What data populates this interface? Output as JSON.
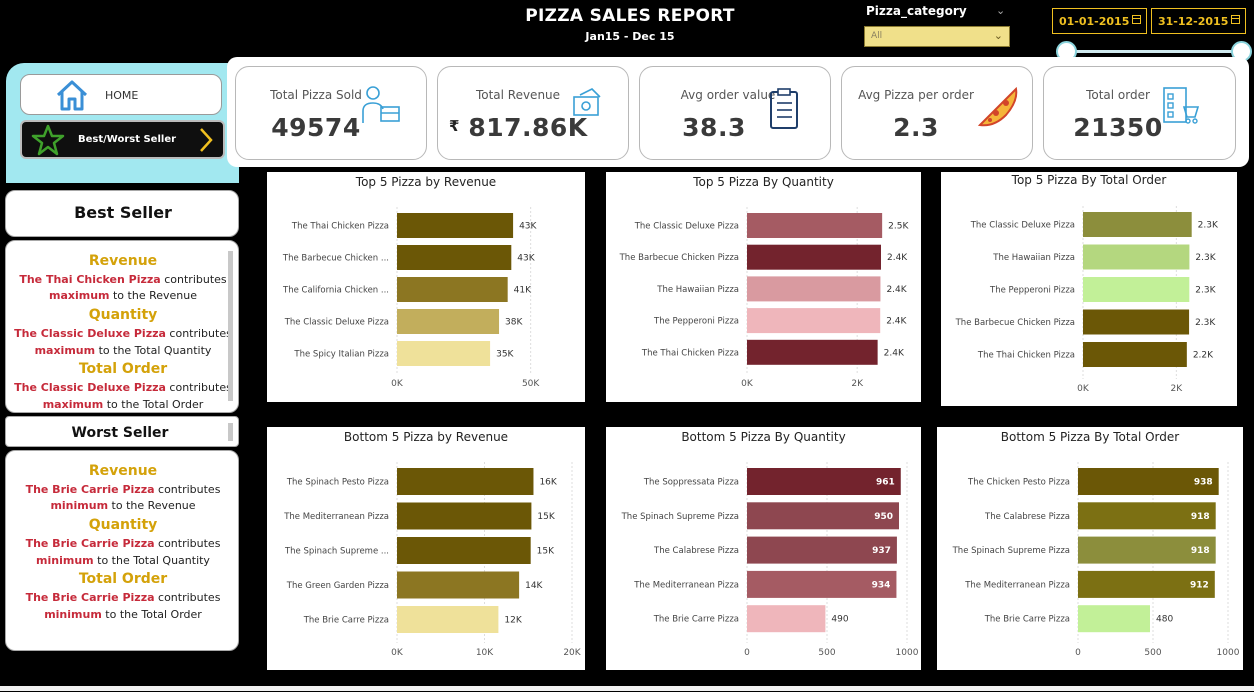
{
  "header": {
    "title": "PIZZA SALES REPORT",
    "subtitle": "Jan15 - Dec 15"
  },
  "filters": {
    "category_label": "Pizza_category",
    "category_value": "All",
    "date_start": "01-01-2015",
    "date_end": "31-12-2015"
  },
  "nav": {
    "home_label": "HOME",
    "bestworst_label": "Best/Worst Seller"
  },
  "kpis": [
    {
      "label": "Total Pizza Sold",
      "value": "49574",
      "icon": "delivery-person-icon"
    },
    {
      "label": "Total Revenue",
      "value": "817.86K",
      "currency": "₹",
      "icon": "money-icon"
    },
    {
      "label": "Avg order value",
      "value": "38.3",
      "icon": "clipboard-icon"
    },
    {
      "label": "Avg Pizza per order",
      "value": "2.3",
      "icon": "pizza-slice-icon"
    },
    {
      "label": "Total order",
      "value": "21350",
      "icon": "order-list-icon"
    }
  ],
  "best_seller": {
    "title": "Best Seller",
    "items": [
      {
        "heading": "Revenue",
        "pizza": "The Thai Chicken Pizza",
        "text1": " contributes",
        "emph": "maximum",
        "text2": " to the Revenue"
      },
      {
        "heading": "Quantity",
        "pizza": "The Classic Deluxe Pizza",
        "text1": " contributes",
        "emph": "maximum",
        "text2": " to the Total Quantity"
      },
      {
        "heading": "Total Order",
        "pizza": "The Classic Deluxe Pizza",
        "text1": " contributes",
        "emph": "maximum",
        "text2": " to the Total Order"
      }
    ]
  },
  "worst_seller": {
    "title": "Worst Seller",
    "items": [
      {
        "heading": "Revenue",
        "pizza": "The Brie Carrie  Pizza",
        "text1": " contributes",
        "emph": "minimum",
        "text2": " to the Revenue"
      },
      {
        "heading": "Quantity",
        "pizza": "The Brie Carrie Pizza",
        "text1": "  contributes",
        "emph": "minimum",
        "text2": " to the Total Quantity"
      },
      {
        "heading": "Total Order",
        "pizza": "The Brie Carrie Pizza",
        "text1": " contributes",
        "emph": "minimum",
        "text2": " to the Total Order"
      }
    ]
  },
  "chart_data": [
    {
      "type": "bar",
      "orientation": "horizontal",
      "title": "Top 5 Pizza by Revenue",
      "categories": [
        "The Thai Chicken Pizza",
        "The Barbecue Chicken ...",
        "The California Chicken ...",
        "The Classic Deluxe Pizza",
        "The Spicy Italian Pizza"
      ],
      "values": [
        43434,
        42768,
        41410,
        38180,
        34831
      ],
      "data_labels": [
        "43K",
        "43K",
        "41K",
        "38K",
        "35K"
      ],
      "colors": [
        "#6b5706",
        "#6b5706",
        "#8c7622",
        "#c2ae5c",
        "#efe19a"
      ],
      "xlim": [
        0,
        55000
      ],
      "ticks": [
        0,
        50000
      ],
      "tick_labels": [
        "0K",
        "50K"
      ],
      "label_inside": false
    },
    {
      "type": "bar",
      "orientation": "horizontal",
      "title": "Top 5 Pizza By Quantity",
      "categories": [
        "The Classic Deluxe Pizza",
        "The Barbecue Chicken Pizza",
        "The Hawaiian Pizza",
        "The Pepperoni Pizza",
        "The Thai Chicken Pizza"
      ],
      "values": [
        2453,
        2432,
        2422,
        2418,
        2371
      ],
      "data_labels": [
        "2.5K",
        "2.4K",
        "2.4K",
        "2.4K",
        "2.4K"
      ],
      "colors": [
        "#a55b63",
        "#73232d",
        "#d99aa0",
        "#efb6bb",
        "#73232d"
      ],
      "xlim": [
        0,
        2650
      ],
      "ticks": [
        0,
        2000
      ],
      "tick_labels": [
        "0K",
        "2K"
      ],
      "label_inside": false
    },
    {
      "type": "bar",
      "orientation": "horizontal",
      "title": "Top 5 Pizza By Total Order",
      "categories": [
        "The Classic Deluxe Pizza",
        "The Hawaiian Pizza",
        "The Pepperoni Pizza",
        "The Barbecue Chicken Pizza",
        "The Thai Chicken Pizza"
      ],
      "values": [
        2329,
        2280,
        2278,
        2273,
        2225
      ],
      "data_labels": [
        "2.3K",
        "2.3K",
        "2.3K",
        "2.3K",
        "2.2K"
      ],
      "colors": [
        "#8c8e3c",
        "#b4d77f",
        "#c2f098",
        "#6b5706",
        "#6b5706"
      ],
      "xlim": [
        0,
        2550
      ],
      "ticks": [
        0,
        2000
      ],
      "tick_labels": [
        "0K",
        "2K"
      ],
      "label_inside": false
    },
    {
      "type": "bar",
      "orientation": "horizontal",
      "title": "Bottom 5 Pizza by Revenue",
      "categories": [
        "The Spinach Pesto Pizza",
        "The Mediterranean Pizza",
        "The Spinach Supreme ...",
        "The Green Garden Pizza",
        "The Brie Carre Pizza"
      ],
      "values": [
        15596,
        15360,
        15278,
        13956,
        11588
      ],
      "data_labels": [
        "16K",
        "15K",
        "15K",
        "14K",
        "12K"
      ],
      "colors": [
        "#6b5706",
        "#6b5706",
        "#6b5706",
        "#8c7622",
        "#efe19a"
      ],
      "xlim": [
        0,
        20000
      ],
      "ticks": [
        0,
        10000,
        20000
      ],
      "tick_labels": [
        "0K",
        "10K",
        "20K"
      ],
      "label_inside": false
    },
    {
      "type": "bar",
      "orientation": "horizontal",
      "title": "Bottom 5 Pizza By Quantity",
      "categories": [
        "The Soppressata Pizza",
        "The Spinach Supreme Pizza",
        "The Calabrese Pizza",
        "The Mediterranean Pizza",
        "The Brie Carre Pizza"
      ],
      "values": [
        961,
        950,
        937,
        934,
        490
      ],
      "data_labels": [
        "961",
        "950",
        "937",
        "934",
        "490"
      ],
      "colors": [
        "#73232d",
        "#8e4750",
        "#8e4750",
        "#a55b63",
        "#efb6bb"
      ],
      "xlim": [
        0,
        1000
      ],
      "ticks": [
        0,
        500,
        1000
      ],
      "tick_labels": [
        "0",
        "500",
        "1000"
      ],
      "label_inside": true
    },
    {
      "type": "bar",
      "orientation": "horizontal",
      "title": "Bottom 5 Pizza By Total Order",
      "categories": [
        "The Chicken Pesto Pizza",
        "The Calabrese Pizza",
        "The Spinach Supreme Pizza",
        "The Mediterranean Pizza",
        "The Brie Carre Pizza"
      ],
      "values": [
        938,
        918,
        918,
        912,
        480
      ],
      "data_labels": [
        "938",
        "918",
        "918",
        "912",
        "480"
      ],
      "colors": [
        "#6b5706",
        "#7c7013",
        "#8c8e3c",
        "#7c7013",
        "#c2f098"
      ],
      "xlim": [
        0,
        1000
      ],
      "ticks": [
        0,
        500,
        1000
      ],
      "tick_labels": [
        "0",
        "500",
        "1000"
      ],
      "label_inside": true
    }
  ]
}
